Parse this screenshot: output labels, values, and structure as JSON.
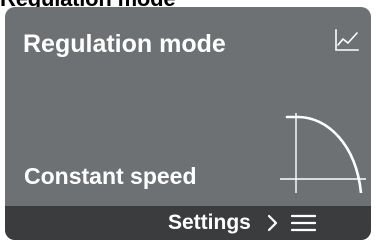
{
  "header": {
    "cutoff_text": "Regulation mode"
  },
  "card": {
    "title": "Regulation mode",
    "mode_value": "Constant speed",
    "trend_icon": "line-chart-icon",
    "mode_icon": "constant-speed-curve-icon",
    "background_color": "#6d7173",
    "footer_color": "#3a3c3e",
    "text_color": "#ffffff"
  },
  "footer": {
    "settings_label": "Settings",
    "chevron_icon": "chevron-right-icon",
    "menu_icon": "menu-icon"
  }
}
